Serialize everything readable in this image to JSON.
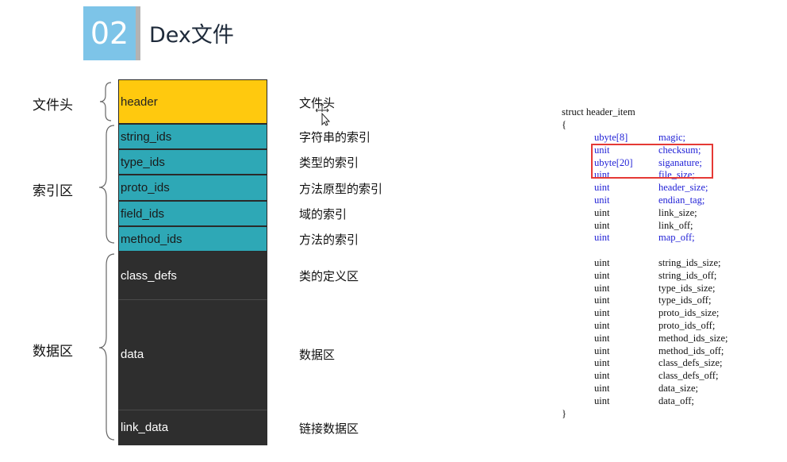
{
  "header": {
    "number": "02",
    "title": "Dex文件"
  },
  "groups": [
    {
      "label": "文件头"
    },
    {
      "label": "索引区"
    },
    {
      "label": "数据区"
    }
  ],
  "blocks": [
    {
      "name": "header",
      "desc": "文件头"
    },
    {
      "name": "string_ids",
      "desc": "字符串的索引"
    },
    {
      "name": "type_ids",
      "desc": "类型的索引"
    },
    {
      "name": "proto_ids",
      "desc": "方法原型的索引"
    },
    {
      "name": "field_ids",
      "desc": "域的索引"
    },
    {
      "name": "method_ids",
      "desc": "方法的索引"
    },
    {
      "name": "class_defs",
      "desc": "类的定义区"
    },
    {
      "name": "data",
      "desc": "数据区"
    },
    {
      "name": "link_data",
      "desc": "链接数据区"
    }
  ],
  "struct": {
    "title": "struct header_item",
    "open": "{",
    "close": "}",
    "fields": [
      {
        "type": "ubyte[8]",
        "name": "magic;"
      },
      {
        "type": "unit",
        "name": "checksum;"
      },
      {
        "type": "ubyte[20]",
        "name": "siganature;"
      },
      {
        "type": "uint",
        "name": "file_size;"
      },
      {
        "type": "uint",
        "name": "header_size;"
      },
      {
        "type": "unit",
        "name": "endian_tag;"
      },
      {
        "type": "uint",
        "name": "link_size;"
      },
      {
        "type": "uint",
        "name": "link_off;"
      },
      {
        "type": "uint",
        "name": "map_off;"
      },
      {
        "type": "uint",
        "name": "string_ids_size;"
      },
      {
        "type": "uint",
        "name": "string_ids_off;"
      },
      {
        "type": "uint",
        "name": "type_ids_size;"
      },
      {
        "type": "uint",
        "name": "type_ids_off;"
      },
      {
        "type": "uint",
        "name": "proto_ids_size;"
      },
      {
        "type": "uint",
        "name": "proto_ids_off;"
      },
      {
        "type": "uint",
        "name": "method_ids_size;"
      },
      {
        "type": "uint",
        "name": "method_ids_off;"
      },
      {
        "type": "uint",
        "name": "class_defs_size;"
      },
      {
        "type": "uint",
        "name": "class_defs_off;"
      },
      {
        "type": "uint",
        "name": "data_size;"
      },
      {
        "type": "uint",
        "name": "data_off;"
      }
    ]
  },
  "colors": {
    "header_block": "#ffc90e",
    "index_block": "#2ea8b6",
    "data_block": "#2e2e2e",
    "badge": "#7dc4e8",
    "code_highlight": "#1f1fd6",
    "box": "#e53935"
  }
}
